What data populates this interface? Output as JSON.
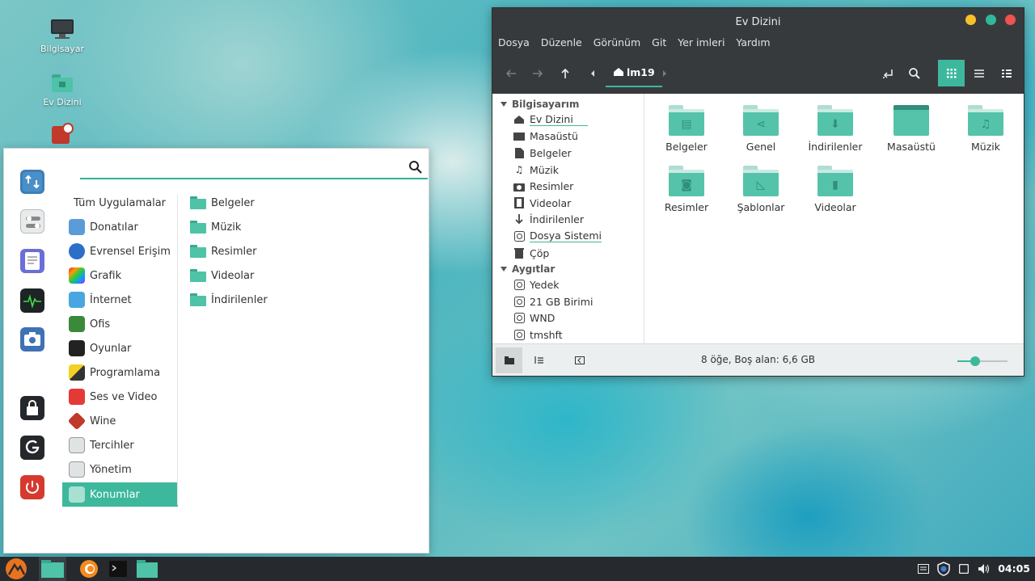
{
  "desktop": {
    "icons": [
      {
        "label": "Bilgisayar",
        "icon": "computer-icon"
      },
      {
        "label": "Ev Dizini",
        "icon": "home-folder-icon"
      },
      {
        "label": "",
        "icon": "installer-icon"
      }
    ]
  },
  "menu": {
    "search_placeholder": "",
    "categories": [
      {
        "label": "Tüm Uygulamalar"
      },
      {
        "label": "Donatılar"
      },
      {
        "label": "Evrensel Erişim"
      },
      {
        "label": "Grafik"
      },
      {
        "label": "İnternet"
      },
      {
        "label": "Ofis"
      },
      {
        "label": "Oyunlar"
      },
      {
        "label": "Programlama"
      },
      {
        "label": "Ses ve Video"
      },
      {
        "label": "Wine"
      },
      {
        "label": "Tercihler"
      },
      {
        "label": "Yönetim"
      },
      {
        "label": "Konumlar"
      }
    ],
    "places": [
      {
        "label": "Belgeler"
      },
      {
        "label": "Müzik"
      },
      {
        "label": "Resimler"
      },
      {
        "label": "Videolar"
      },
      {
        "label": "İndirilenler"
      }
    ],
    "side_buttons": [
      "software-manager-icon",
      "settings-icon",
      "text-editor-icon",
      "system-monitor-icon",
      "camera-icon",
      "lock-icon",
      "logout-icon",
      "power-icon"
    ]
  },
  "file_manager": {
    "title": "Ev Dizini",
    "menubar": [
      "Dosya",
      "Düzenle",
      "Görünüm",
      "Git",
      "Yer imleri",
      "Yardım"
    ],
    "breadcrumb": "lm19",
    "sidebar": {
      "group1": "Bilgisayarım",
      "items1": [
        "Ev Dizini",
        "Masaüstü",
        "Belgeler",
        "Müzik",
        "Resimler",
        "Videolar",
        "İndirilenler",
        "Dosya Sistemi",
        "Çöp"
      ],
      "group2": "Aygıtlar",
      "items2": [
        "Yedek",
        "21 GB Birimi",
        "WND",
        "tmshft"
      ]
    },
    "files": [
      "Belgeler",
      "Genel",
      "İndirilenler",
      "Masaüstü",
      "Müzik",
      "Resimler",
      "Şablonlar",
      "Videolar"
    ],
    "status": "8 öğe, Boş alan: 6,6 GB",
    "zoom_level": 0.35
  },
  "taskbar": {
    "clock": "04:05"
  }
}
